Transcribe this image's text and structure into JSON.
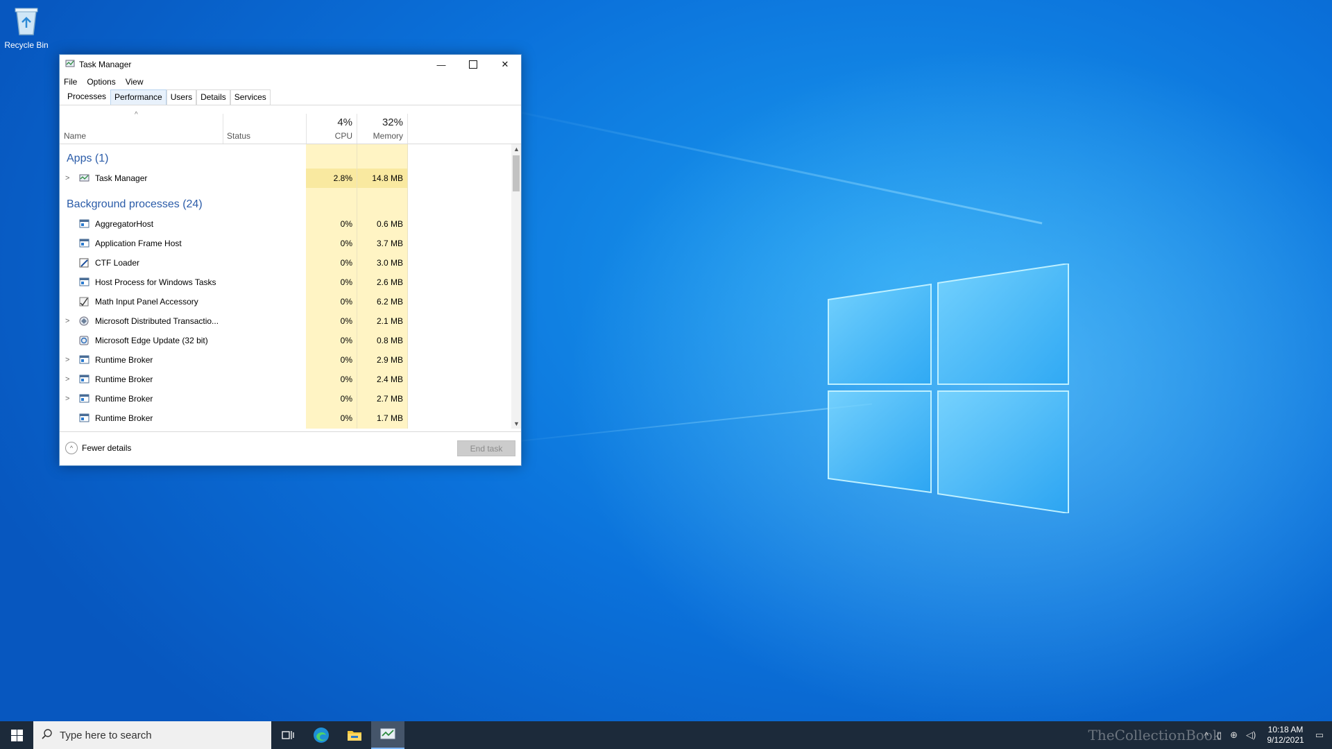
{
  "desktop": {
    "recycle_bin_label": "Recycle Bin"
  },
  "window": {
    "title": "Task Manager",
    "menu": [
      "File",
      "Options",
      "View"
    ],
    "tabs": [
      "Processes",
      "Performance",
      "Users",
      "Details",
      "Services"
    ],
    "columns": {
      "name": "Name",
      "status": "Status",
      "cpu_label": "CPU",
      "cpu_pct": "4%",
      "memory_label": "Memory",
      "memory_pct": "32%"
    },
    "groups": {
      "apps": "Apps (1)",
      "background": "Background processes (24)"
    },
    "apps": [
      {
        "name": "Task Manager",
        "cpu": "2.8%",
        "mem": "14.8 MB",
        "expandable": true,
        "icon": "task-manager-icon"
      }
    ],
    "background": [
      {
        "name": "AggregatorHost",
        "cpu": "0%",
        "mem": "0.6 MB",
        "expandable": false,
        "icon": "window-app-icon"
      },
      {
        "name": "Application Frame Host",
        "cpu": "0%",
        "mem": "3.7 MB",
        "expandable": false,
        "icon": "window-app-icon"
      },
      {
        "name": "CTF Loader",
        "cpu": "0%",
        "mem": "3.0 MB",
        "expandable": false,
        "icon": "ctf-loader-icon"
      },
      {
        "name": "Host Process for Windows Tasks",
        "cpu": "0%",
        "mem": "2.6 MB",
        "expandable": false,
        "icon": "window-app-icon"
      },
      {
        "name": "Math Input Panel Accessory",
        "cpu": "0%",
        "mem": "6.2 MB",
        "expandable": false,
        "icon": "math-input-icon"
      },
      {
        "name": "Microsoft Distributed Transactio...",
        "cpu": "0%",
        "mem": "2.1 MB",
        "expandable": true,
        "icon": "distributed-transaction-icon"
      },
      {
        "name": "Microsoft Edge Update (32 bit)",
        "cpu": "0%",
        "mem": "0.8 MB",
        "expandable": false,
        "icon": "edge-update-icon"
      },
      {
        "name": "Runtime Broker",
        "cpu": "0%",
        "mem": "2.9 MB",
        "expandable": true,
        "icon": "window-app-icon"
      },
      {
        "name": "Runtime Broker",
        "cpu": "0%",
        "mem": "2.4 MB",
        "expandable": true,
        "icon": "window-app-icon"
      },
      {
        "name": "Runtime Broker",
        "cpu": "0%",
        "mem": "2.7 MB",
        "expandable": true,
        "icon": "window-app-icon"
      },
      {
        "name": "Runtime Broker",
        "cpu": "0%",
        "mem": "1.7 MB",
        "expandable": false,
        "icon": "window-app-icon"
      }
    ],
    "footer": {
      "fewer_details": "Fewer details",
      "end_task": "End task"
    }
  },
  "taskbar": {
    "search_placeholder": "Type here to search",
    "watermark": "TheCollectionBook",
    "time": "10:18 AM",
    "date": "9/12/2021"
  },
  "colors": {
    "group_header": "#2a5ba8",
    "cpu_mem_column": "#fff4c4",
    "highlight": "#f9e9a0",
    "taskbar": "#1c2a3a"
  }
}
